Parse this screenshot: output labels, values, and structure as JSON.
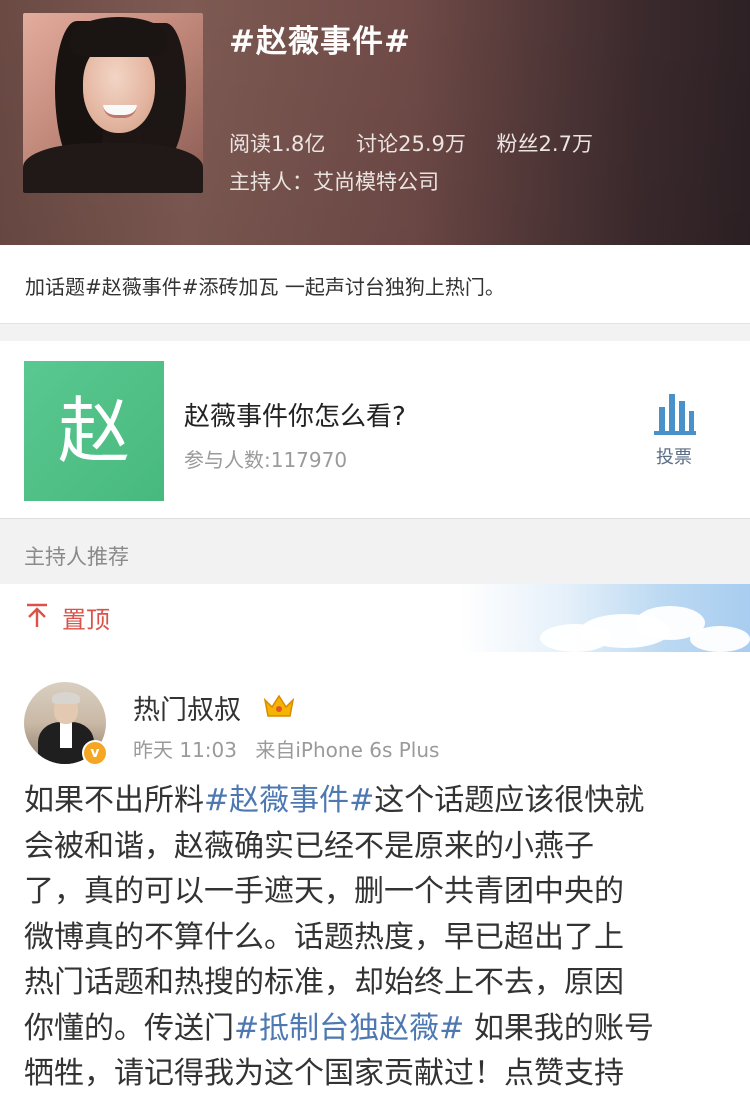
{
  "header": {
    "topic_title": "#赵薇事件#",
    "stats": {
      "reads": "阅读1.8亿",
      "discussions": "讨论25.9万",
      "fans": "粉丝2.7万"
    },
    "host": "主持人：艾尚模特公司"
  },
  "intro": {
    "text": "加话题#赵薇事件#添砖加瓦 一起声讨台独狗上热门。"
  },
  "poll": {
    "thumb_char": "赵",
    "title": "赵薇事件你怎么看?",
    "participants": "参与人数:117970",
    "vote_label": "投票",
    "thumb_color": "#52c289"
  },
  "section": {
    "title": "主持人推荐"
  },
  "pinned": {
    "label": "置顶",
    "accent_color": "#d9534a"
  },
  "post": {
    "user_name": "热门叔叔",
    "verified_badge": "v",
    "time": "昨天 11:03",
    "source": "来自iPhone 6s Plus",
    "lines": [
      [
        {
          "t": "如果不出所料"
        },
        {
          "t": "#赵薇事件#",
          "tag": true
        },
        {
          "t": "这个话题应该很快就"
        }
      ],
      [
        {
          "t": "会被和谐，赵薇确实已经不是原来的小燕子"
        }
      ],
      [
        {
          "t": "了，真的可以一手遮天，删一个共青团中央的"
        }
      ],
      [
        {
          "t": "微博真的不算什么。话题热度，早已超出了上"
        }
      ],
      [
        {
          "t": "热门话题和热搜的标准，却始终上不去，原因"
        }
      ],
      [
        {
          "t": "你懂的。传送门"
        },
        {
          "t": "#抵制台独赵薇#",
          "tag": true
        },
        {
          "t": " 如果我的账号"
        }
      ],
      [
        {
          "t": "牺牲，请记得我为这个国家贡献过！点赞支持"
        }
      ]
    ],
    "link_color": "#4d78b1"
  }
}
